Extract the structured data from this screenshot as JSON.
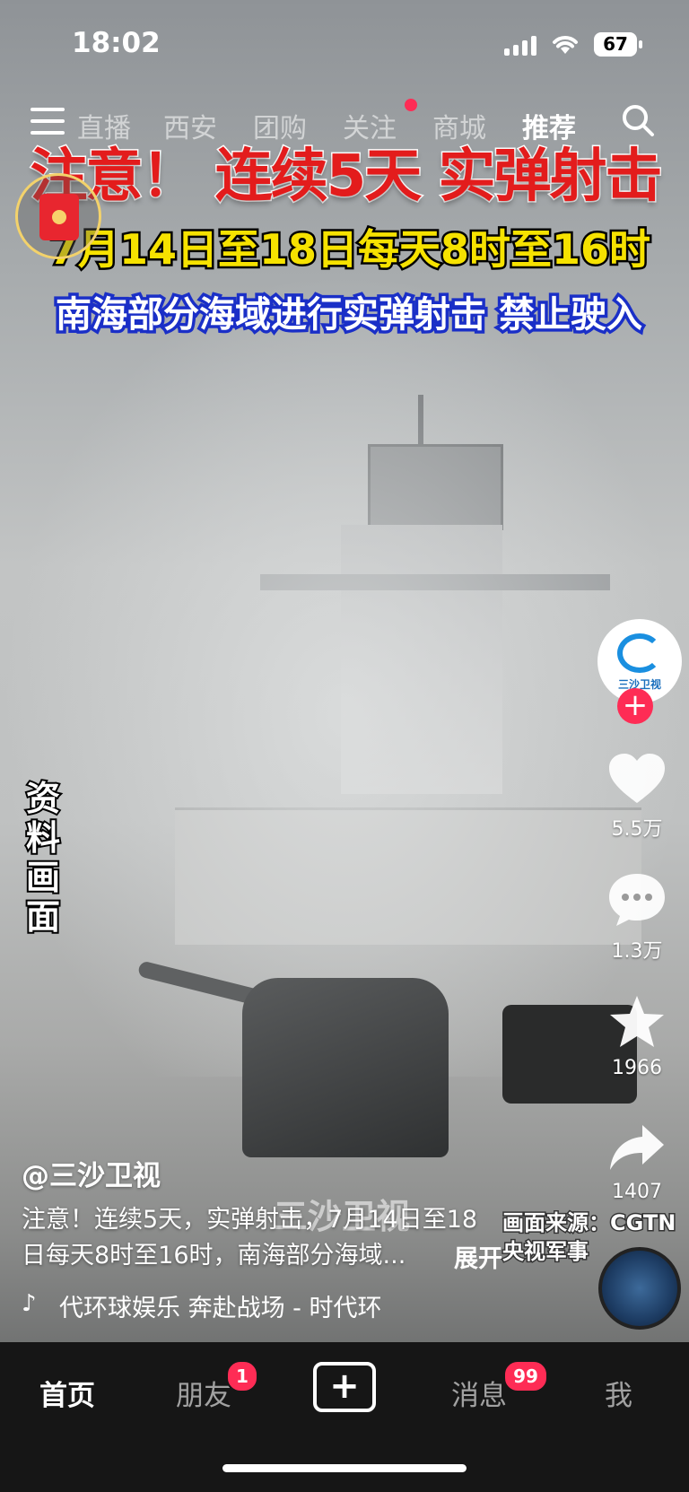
{
  "status_bar": {
    "time": "18:02",
    "battery": "67"
  },
  "top_tabs": [
    {
      "label": "直播",
      "active": false
    },
    {
      "label": "西安",
      "active": false
    },
    {
      "label": "团购",
      "active": false
    },
    {
      "label": "关注",
      "active": false,
      "has_dot": true
    },
    {
      "label": "商城",
      "active": false
    },
    {
      "label": "推荐",
      "active": true
    }
  ],
  "video": {
    "headline": "注意！ 连续5天 实弹射击",
    "subline": "7月14日至18日每天8时至16时",
    "notice": "南海部分海域进行实弹射击 禁止驶入",
    "side_note": "资料画面",
    "source": "画面来源：CGTN\n央视军事",
    "watermark": "三沙卫视"
  },
  "creator": {
    "avatar_label": "三沙卫视"
  },
  "actions": {
    "likes": "5.5万",
    "comments": "1.3万",
    "favorites": "1966",
    "shares": "1407"
  },
  "post": {
    "author": "@三沙卫视",
    "description": "注意！连续5天，实弹射击，7月14日至18日每天8时至16时，南海部分海域...",
    "expand": "展开",
    "music": "代环球娱乐   奔赴战场 - 时代环"
  },
  "bottom_nav": {
    "home": "首页",
    "friends": "朋友",
    "friends_badge": "1",
    "messages": "消息",
    "messages_badge": "99",
    "me": "我"
  },
  "colors": {
    "accent": "#fe2c55",
    "banner_red": "#e31c1c",
    "banner_yellow": "#f6e200",
    "banner_blue": "#1a2fc7"
  }
}
